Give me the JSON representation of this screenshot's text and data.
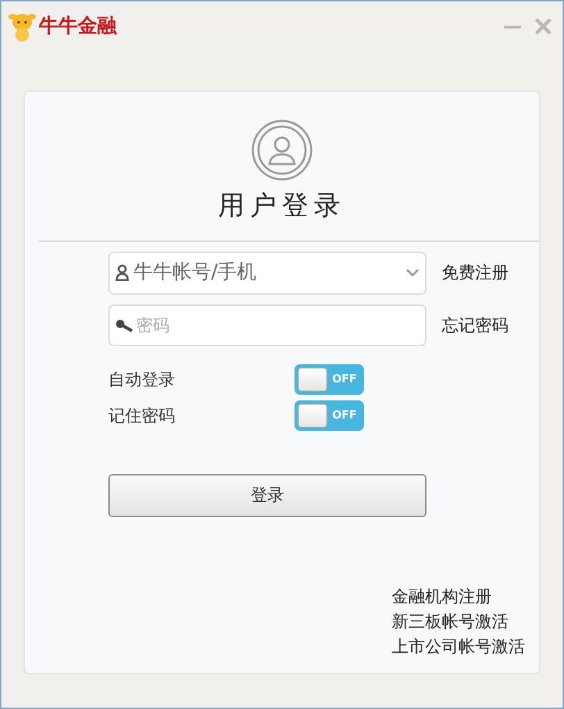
{
  "window": {
    "title": "牛牛金融"
  },
  "heading": "用户登录",
  "account_field": {
    "value": "牛牛帐号/手机"
  },
  "register_link": "免费注册",
  "password_field": {
    "placeholder": "密码"
  },
  "forgot_link": "忘记密码",
  "options": [
    {
      "label": "自动登录",
      "on": false,
      "state_text": "OFF"
    },
    {
      "label": "记住密码",
      "on": false,
      "state_text": "OFF"
    }
  ],
  "login_button": "登录",
  "footer_links": [
    "金融机构注册",
    "新三板帐号激活",
    "上市公司帐号激活"
  ]
}
